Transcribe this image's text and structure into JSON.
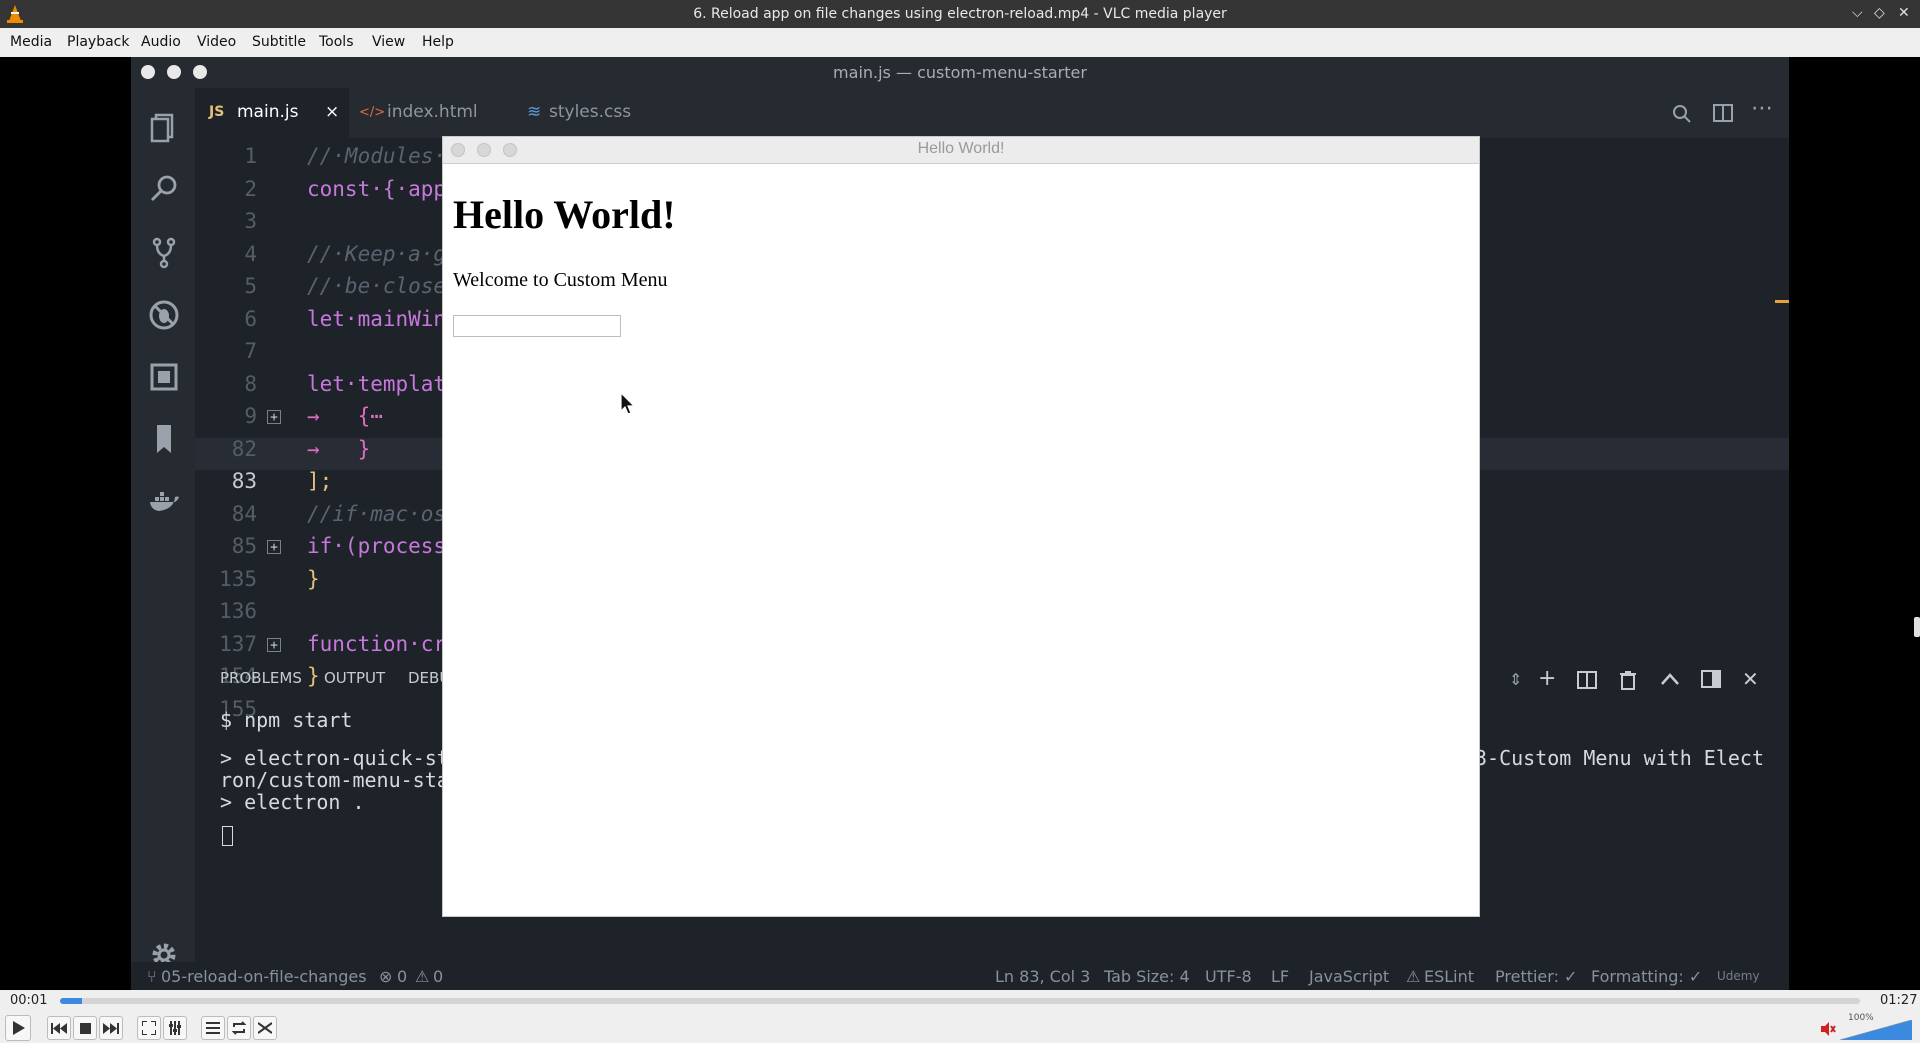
{
  "vlc": {
    "title": "6. Reload app on file changes using electron-reload.mp4 - VLC media player",
    "menu": [
      "Media",
      "Playback",
      "Audio",
      "Video",
      "Subtitle",
      "Tools",
      "View",
      "Help"
    ],
    "time_elapsed": "00:01",
    "time_total": "01:27",
    "progress": 0.012,
    "volume_label": "100%",
    "volume_level": 1.0
  },
  "vscode": {
    "title": "main.js — custom-menu-starter",
    "tabs": [
      {
        "icon_text": "JS",
        "label": "main.js",
        "active": true,
        "close": "×"
      },
      {
        "icon_text": "</>",
        "label": "index.html",
        "active": false
      },
      {
        "icon_text": "≋",
        "label": "styles.css",
        "active": false
      }
    ],
    "code_lines": [
      {
        "num": "1",
        "text": "//·Modules·"
      },
      {
        "num": "2",
        "text": "const·{·app"
      },
      {
        "num": "3",
        "text": ""
      },
      {
        "num": "4",
        "text": "//·Keep·a·g"
      },
      {
        "num": "5",
        "text": "//·be·close"
      },
      {
        "num": "6",
        "text": "let·mainWin"
      },
      {
        "num": "7",
        "text": ""
      },
      {
        "num": "8",
        "text": "let·templat"
      },
      {
        "num": "9",
        "text": "→   {⋯"
      },
      {
        "num": "82",
        "text": "→   }"
      },
      {
        "num": "83",
        "text": "];"
      },
      {
        "num": "84",
        "text": "//if·mac·os"
      },
      {
        "num": "85",
        "text": "if·(process"
      },
      {
        "num": "135",
        "text": "}"
      },
      {
        "num": "136",
        "text": ""
      },
      {
        "num": "137",
        "text": "function·cr"
      },
      {
        "num": "154",
        "text": "}"
      },
      {
        "num": "155",
        "text": ""
      }
    ],
    "panel_tabs": [
      "PROBLEMS",
      "OUTPUT",
      "DEBU"
    ],
    "terminal": {
      "line1": "$ npm start",
      "line2": "> electron-quick-st",
      "line3": "ron/custom-menu-sta",
      "line4": "> electron .",
      "right_fragment": "3-Custom Menu with Elect"
    },
    "status": {
      "branch": "05-reload-on-file-changes",
      "errors": "0",
      "warnings": "0",
      "position": "Ln 83, Col 3",
      "tab_size": "Tab Size: 4",
      "encoding": "UTF-8",
      "eol": "LF",
      "language": "JavaScript",
      "eslint": "ESLint",
      "prettier": "Prettier: ✓",
      "formatting": "Formatting: ✓",
      "watermark": "Udemy"
    }
  },
  "app": {
    "title": "Hello World!",
    "heading": "Hello World!",
    "text": "Welcome to Custom Menu",
    "input_value": ""
  }
}
